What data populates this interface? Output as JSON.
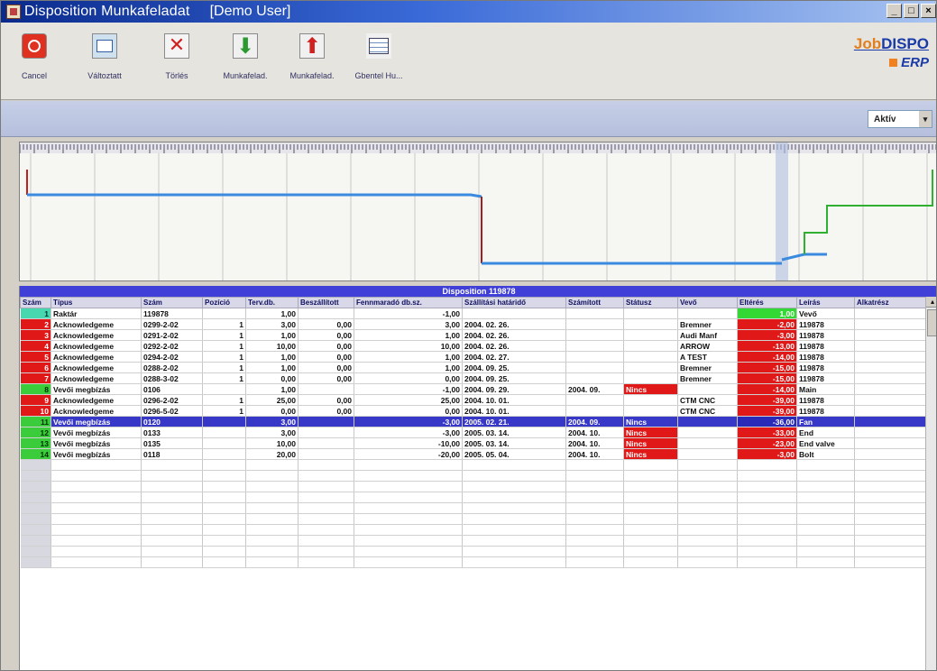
{
  "window": {
    "title": "Disposition Munkafeladat",
    "user": "[Demo User]",
    "min_label": "_",
    "max_label": "□",
    "close_label": "×"
  },
  "toolbar": {
    "buttons": [
      {
        "label": "Cancel",
        "icon": "cancel-icon"
      },
      {
        "label": "Változtatt",
        "icon": "edit-icon"
      },
      {
        "label": "Törlés",
        "icon": "delete-icon"
      },
      {
        "label": "Munkafelad.",
        "icon": "arrow-down-icon"
      },
      {
        "label": "Munkafelad.",
        "icon": "arrow-up-icon"
      },
      {
        "label": "Gbentel Hu...",
        "icon": "gantt-icon"
      }
    ]
  },
  "logo": {
    "line1_a": "Job",
    "line1_b": "DISPO",
    "line2": "ERP"
  },
  "filter": {
    "value": "Aktív"
  },
  "grid": {
    "title": "Disposition 119878",
    "columns": [
      "Szám",
      "Típus",
      "Szám",
      "Pozíció",
      "Terv.db.",
      "Beszállított",
      "Fennmaradó db.sz.",
      "Szállítási határidő",
      "Számított",
      "Státusz",
      "Vevő",
      "Eltérés",
      "Leírás",
      "Alkatrész"
    ],
    "rows": [
      {
        "idx": "1",
        "idx_color": "teal",
        "tipus": "Raktár",
        "szam": "119878",
        "poz": "",
        "terv": "1,00",
        "besz": "",
        "fenn": "-1,00",
        "szall": "",
        "szam2": "",
        "statusz": "",
        "status_color": "",
        "vevo": "",
        "elt": "1,00",
        "elt_color": "green",
        "leiras": "Vevő",
        "alk": ""
      },
      {
        "idx": "2",
        "idx_color": "red",
        "tipus": "Acknowledgeme",
        "szam": "0299-2-02",
        "poz": "1",
        "terv": "3,00",
        "besz": "0,00",
        "fenn": "3,00",
        "szall": "2004. 02. 26.",
        "szam2": "",
        "statusz": "",
        "status_color": "",
        "vevo": "Bremner",
        "elt": "-2,00",
        "elt_color": "red",
        "leiras": "119878",
        "alk": ""
      },
      {
        "idx": "3",
        "idx_color": "red",
        "tipus": "Acknowledgeme",
        "szam": "0291-2-02",
        "poz": "1",
        "terv": "1,00",
        "besz": "0,00",
        "fenn": "1,00",
        "szall": "2004. 02. 26.",
        "szam2": "",
        "statusz": "",
        "status_color": "",
        "vevo": "Audi Manf",
        "elt": "-3,00",
        "elt_color": "red",
        "leiras": "119878",
        "alk": ""
      },
      {
        "idx": "4",
        "idx_color": "red",
        "tipus": "Acknowledgeme",
        "szam": "0292-2-02",
        "poz": "1",
        "terv": "10,00",
        "besz": "0,00",
        "fenn": "10,00",
        "szall": "2004. 02. 26.",
        "szam2": "",
        "statusz": "",
        "status_color": "",
        "vevo": "ARROW",
        "elt": "-13,00",
        "elt_color": "red",
        "leiras": "119878",
        "alk": ""
      },
      {
        "idx": "5",
        "idx_color": "red",
        "tipus": "Acknowledgeme",
        "szam": "0294-2-02",
        "poz": "1",
        "terv": "1,00",
        "besz": "0,00",
        "fenn": "1,00",
        "szall": "2004. 02. 27.",
        "szam2": "",
        "statusz": "",
        "status_color": "",
        "vevo": "A TEST",
        "elt": "-14,00",
        "elt_color": "red",
        "leiras": "119878",
        "alk": ""
      },
      {
        "idx": "6",
        "idx_color": "red",
        "tipus": "Acknowledgeme",
        "szam": "0288-2-02",
        "poz": "1",
        "terv": "1,00",
        "besz": "0,00",
        "fenn": "1,00",
        "szall": "2004. 09. 25.",
        "szam2": "",
        "statusz": "",
        "status_color": "",
        "vevo": "Bremner",
        "elt": "-15,00",
        "elt_color": "red",
        "leiras": "119878",
        "alk": ""
      },
      {
        "idx": "7",
        "idx_color": "red",
        "tipus": "Acknowledgeme",
        "szam": "0288-3-02",
        "poz": "1",
        "terv": "0,00",
        "besz": "0,00",
        "fenn": "0,00",
        "szall": "2004. 09. 25.",
        "szam2": "",
        "statusz": "",
        "status_color": "",
        "vevo": "Bremner",
        "elt": "-15,00",
        "elt_color": "red",
        "leiras": "119878",
        "alk": ""
      },
      {
        "idx": "8",
        "idx_color": "green",
        "tipus": "Vevői megbízás",
        "szam": "0106",
        "poz": "",
        "terv": "1,00",
        "besz": "",
        "fenn": "-1,00",
        "szall": "2004. 09. 29.",
        "szam2": "2004. 09.",
        "statusz": "Nincs",
        "status_color": "red",
        "vevo": "",
        "elt": "-14,00",
        "elt_color": "red",
        "leiras": "Main",
        "alk": ""
      },
      {
        "idx": "9",
        "idx_color": "red",
        "tipus": "Acknowledgeme",
        "szam": "0296-2-02",
        "poz": "1",
        "terv": "25,00",
        "besz": "0,00",
        "fenn": "25,00",
        "szall": "2004. 10. 01.",
        "szam2": "",
        "statusz": "",
        "status_color": "",
        "vevo": "CTM CNC",
        "elt": "-39,00",
        "elt_color": "red",
        "leiras": "119878",
        "alk": ""
      },
      {
        "idx": "10",
        "idx_color": "red",
        "tipus": "Acknowledgeme",
        "szam": "0296-5-02",
        "poz": "1",
        "terv": "0,00",
        "besz": "0,00",
        "fenn": "0,00",
        "szall": "2004. 10. 01.",
        "szam2": "",
        "statusz": "",
        "status_color": "",
        "vevo": "CTM CNC",
        "elt": "-39,00",
        "elt_color": "red",
        "leiras": "119878",
        "alk": ""
      },
      {
        "idx": "11",
        "idx_color": "green",
        "tipus": "Vevői megbízás",
        "szam": "0120",
        "poz": "",
        "terv": "3,00",
        "besz": "",
        "fenn": "-3,00",
        "szall": "2005. 02. 21.",
        "szam2": "2004. 09.",
        "statusz": "Nincs",
        "status_color": "",
        "vevo": "",
        "elt": "-36,00",
        "elt_color": "sel",
        "leiras": "Fan",
        "alk": "",
        "selected": true
      },
      {
        "idx": "12",
        "idx_color": "green",
        "tipus": "Vevői megbízás",
        "szam": "0133",
        "poz": "",
        "terv": "3,00",
        "besz": "",
        "fenn": "-3,00",
        "szall": "2005. 03. 14.",
        "szam2": "2004. 10.",
        "statusz": "Nincs",
        "status_color": "red",
        "vevo": "",
        "elt": "-33,00",
        "elt_color": "red",
        "leiras": "End",
        "alk": ""
      },
      {
        "idx": "13",
        "idx_color": "green",
        "tipus": "Vevői megbízás",
        "szam": "0135",
        "poz": "",
        "terv": "10,00",
        "besz": "",
        "fenn": "-10,00",
        "szall": "2005. 03. 14.",
        "szam2": "2004. 10.",
        "statusz": "Nincs",
        "status_color": "red",
        "vevo": "",
        "elt": "-23,00",
        "elt_color": "red",
        "leiras": "End valve",
        "alk": ""
      },
      {
        "idx": "14",
        "idx_color": "green",
        "tipus": "Vevői megbízás",
        "szam": "0118",
        "poz": "",
        "terv": "20,00",
        "besz": "",
        "fenn": "-20,00",
        "szall": "2005. 05. 04.",
        "szam2": "2004. 10.",
        "statusz": "Nincs",
        "status_color": "red",
        "vevo": "",
        "elt": "-3,00",
        "elt_color": "red",
        "leiras": "Bolt",
        "alk": ""
      }
    ]
  },
  "colors": {
    "accent": "#3838c8",
    "negative": "#e01818",
    "positive": "#34d834"
  }
}
